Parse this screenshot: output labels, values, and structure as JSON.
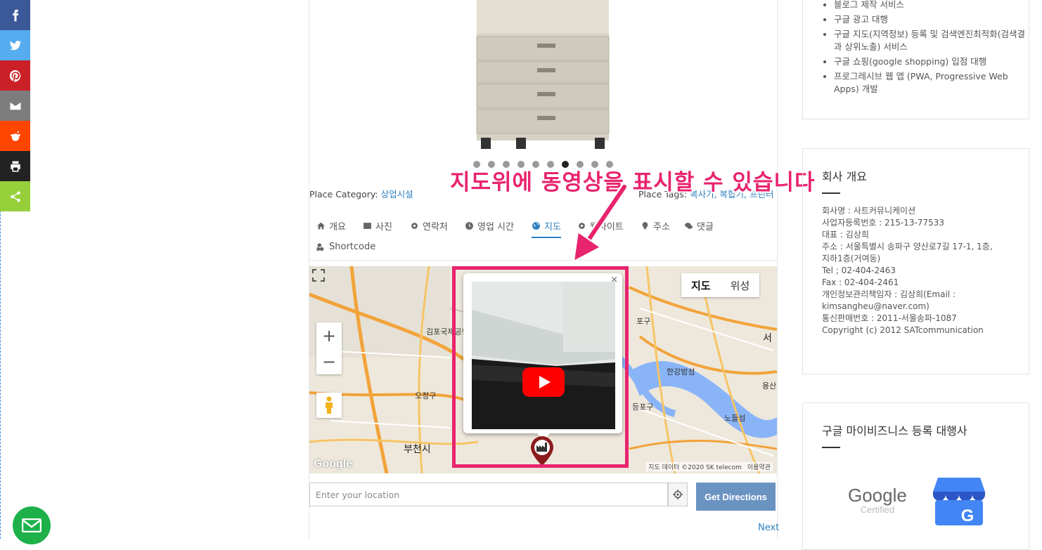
{
  "share_bar": {
    "items": [
      {
        "name": "facebook",
        "color": "#3b5998",
        "glyph": "f"
      },
      {
        "name": "twitter",
        "color": "#55acee",
        "glyph": "t"
      },
      {
        "name": "pinterest",
        "color": "#cb2027",
        "glyph": "p"
      },
      {
        "name": "email",
        "color": "#7d7d7d",
        "glyph": "e"
      },
      {
        "name": "reddit",
        "color": "#ff4500",
        "glyph": "r"
      },
      {
        "name": "print",
        "color": "#222222",
        "glyph": "pr"
      },
      {
        "name": "share",
        "color": "#95d03a",
        "glyph": "s"
      }
    ]
  },
  "place": {
    "category_label": "Place Category:",
    "category_value": "상업시설",
    "tags_label": "Place Tags:",
    "tags_value": "복사기, 복합기, 프린터",
    "slider_dots": 10,
    "active_dot": 6
  },
  "tabs": [
    {
      "label": "개요",
      "icon": "home-icon"
    },
    {
      "label": "사진",
      "icon": "image-icon"
    },
    {
      "label": "연락처",
      "icon": "gear-icon"
    },
    {
      "label": "영업 시간",
      "icon": "clock-icon"
    },
    {
      "label": "지도",
      "icon": "globe-icon",
      "active": true
    },
    {
      "label": "웹사이트",
      "icon": "gear-icon"
    },
    {
      "label": "주소",
      "icon": "map-pin-icon"
    },
    {
      "label": "댓글",
      "icon": "comments-icon"
    },
    {
      "label": "Shortcode",
      "icon": "cubes-icon"
    }
  ],
  "map": {
    "type_map": "지도",
    "type_satellite": "위성",
    "zoom_in": "+",
    "zoom_out": "−",
    "labels": [
      "김포국제공항",
      "오정구",
      "부천시",
      "한강밤섬",
      "노들섬",
      "용산",
      "등포구",
      "포구",
      "서"
    ],
    "attribution": "지도 데이터 ©2020 SK telecom",
    "terms": "이용약관",
    "logo": "Google",
    "infowindow_close": "×"
  },
  "annotation": {
    "text": "지도위에 동영상을 표시할 수 있습니다",
    "color": "#e8246e"
  },
  "directions": {
    "placeholder": "Enter your location",
    "button": "Get Directions",
    "next": "Next"
  },
  "sidebar": {
    "services": [
      "블로그 제작 서비스",
      "구글 광고 대행",
      "구글 지도(지역정보) 등록 및 검색엔진최적화(검색결과 상위노출) 서비스",
      "구글 쇼핑(google shopping) 입점 대행",
      "프로그레시브 웹 앱 (PWA, Progressive Web Apps) 개발"
    ],
    "company_title": "회사 개요",
    "company_lines": [
      "회사명 : 사트커뮤니케이션",
      "사업자등록번호 : 215-13-77533",
      "대표 : 김상희",
      "주소 : 서울특별시 송파구 양산로7길 17-1, 1층,",
      "지하1층(거여동)",
      "Tel ; 02-404-2463",
      "Fax : 02-404-2461",
      "개인정보관리책임자 : 김상희(Email :",
      "kimsangheu@naver.com)",
      "통신판매번호 : 2011-서울송파-1087",
      "Copyright (c) 2012 SATcommunication"
    ],
    "mybiz_title": "구글 마이비즈니스 등록 대행사",
    "google_word": "Google",
    "certified_word": "Certified",
    "gmb_letter": "G"
  }
}
